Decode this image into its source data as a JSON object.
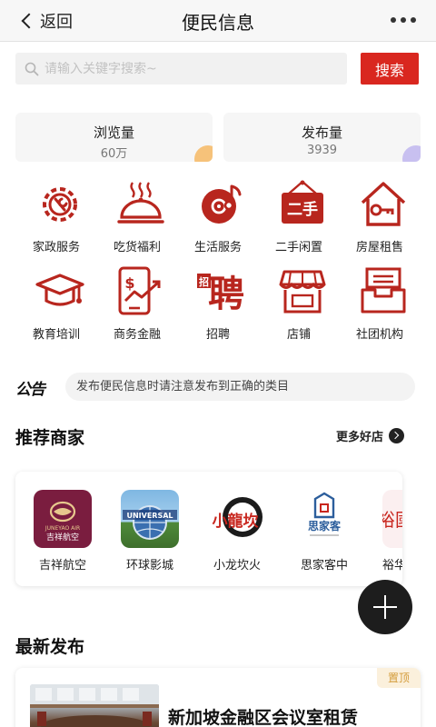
{
  "nav": {
    "back_label": "返回",
    "title": "便民信息"
  },
  "search": {
    "placeholder": "请输入关键字搜索~",
    "value": "",
    "button_label": "搜索"
  },
  "stats": [
    {
      "label": "浏览量",
      "value": "60万",
      "accent": "#f6c27a"
    },
    {
      "label": "发布量",
      "value": "3939",
      "accent": "#c8c0f0"
    }
  ],
  "categories": [
    {
      "label": "家政服务",
      "icon": "gear-wrench-icon"
    },
    {
      "label": "吃货福利",
      "icon": "food-cloche-icon"
    },
    {
      "label": "生活服务",
      "icon": "music-disc-icon"
    },
    {
      "label": "二手闲置",
      "icon": "second-hand-sign-icon"
    },
    {
      "label": "房屋租售",
      "icon": "house-key-icon"
    },
    {
      "label": "教育培训",
      "icon": "graduation-cap-icon"
    },
    {
      "label": "商务金融",
      "icon": "finance-phone-icon"
    },
    {
      "label": "招聘",
      "icon": "recruit-icon",
      "glyph": "聘",
      "small_glyph": "招"
    },
    {
      "label": "店铺",
      "icon": "storefront-icon"
    },
    {
      "label": "社团机构",
      "icon": "inbox-tray-icon"
    }
  ],
  "notice": {
    "logo": "公告",
    "text": "发布便民信息时请注意发布到正确的类目"
  },
  "merchants_section": {
    "title": "推荐商家",
    "more_label": "更多好店"
  },
  "merchants": [
    {
      "name": "吉祥航空",
      "logo_text": "吉祥航空",
      "logo_sub": "JUNEYAO AIR"
    },
    {
      "name": "环球影城",
      "logo_text": "UNIVERSAL"
    },
    {
      "name": "小龙坎火",
      "logo_text": "小龍坎"
    },
    {
      "name": "思家客中",
      "logo_text": "思家客"
    },
    {
      "name": "裕华",
      "logo_text": "裕國"
    }
  ],
  "latest_section": {
    "title": "最新发布"
  },
  "latest": [
    {
      "title": "新加坡金融区会议室租赁",
      "badge": "置顶"
    }
  ],
  "colors": {
    "brand_red": "#d9271f",
    "icon_red": "#b8261e"
  }
}
